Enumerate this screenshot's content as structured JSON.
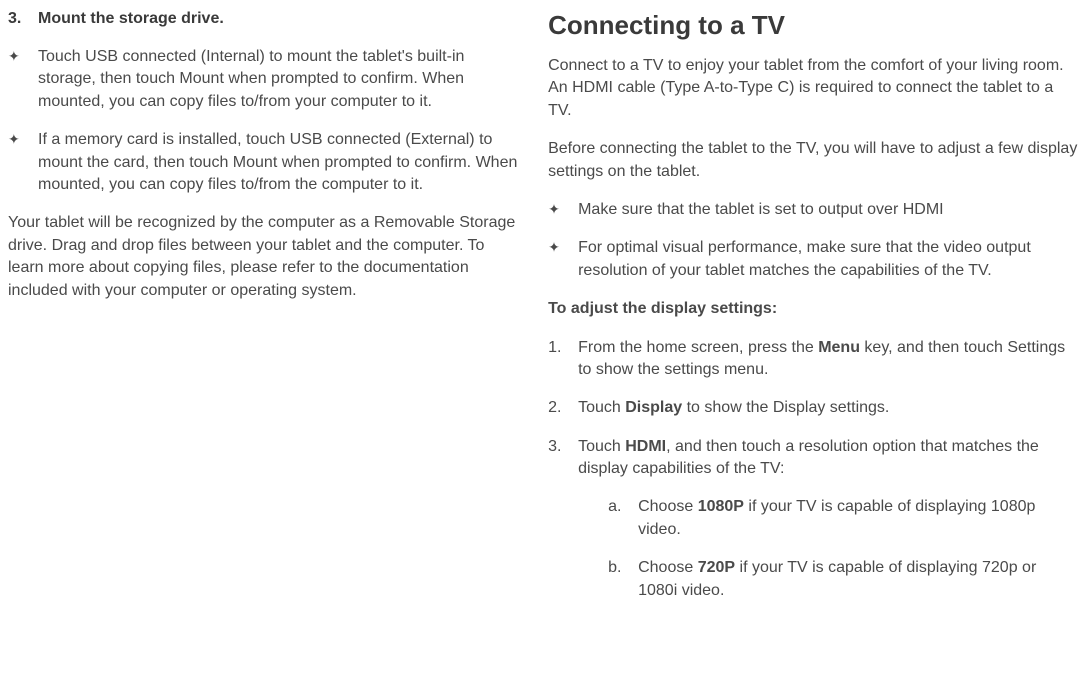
{
  "left": {
    "step3_num": "3.",
    "step3_title": "Mount the storage drive.",
    "bullets": [
      "Touch USB connected (Internal) to mount the tablet's built-in storage, then touch Mount when prompted to confirm. When mounted, you can copy files to/from your computer to it.",
      "If a memory card is installed, touch USB connected (External) to mount the card, then touch Mount when prompted to confirm. When mounted, you can copy files to/from the computer to it."
    ],
    "paragraph": "Your tablet will be recognized by the computer as a Removable Storage drive. Drag and drop files between your tablet and the computer. To learn more about copying files, please refer to the documentation included with your computer or operating system."
  },
  "right": {
    "heading": "Connecting to a TV",
    "intro": "Connect to a TV to enjoy your tablet from the comfort of your living room. An HDMI cable (Type A-to-Type C) is required to connect the tablet to a TV.",
    "pre_list": "Before connecting the tablet to the TV, you will have to adjust a few display settings on the tablet.",
    "bullets": [
      "Make sure that the tablet is set to output over HDMI",
      "For optimal visual performance, make sure that the video output resolution of your tablet matches the capabilities of the TV."
    ],
    "adjust_heading": "To adjust the display settings:",
    "steps": {
      "s1_num": "1.",
      "s1_pre": "From the home screen, press the ",
      "s1_bold": "Menu",
      "s1_post": " key, and then touch Settings to show the settings menu.",
      "s2_num": "2.",
      "s2_pre": "Touch ",
      "s2_bold": "Display",
      "s2_post": " to show the Display settings.",
      "s3_num": "3.",
      "s3_pre": "Touch ",
      "s3_bold": "HDMI",
      "s3_post": ", and then touch a resolution option that matches the display capabilities of the TV:",
      "a_num": "a.",
      "a_pre": "Choose ",
      "a_bold": "1080P",
      "a_post": " if your TV is capable of displaying 1080p video.",
      "b_num": "b.",
      "b_pre": "Choose ",
      "b_bold": "720P",
      "b_post": " if your TV is capable of displaying 720p or 1080i video."
    }
  }
}
